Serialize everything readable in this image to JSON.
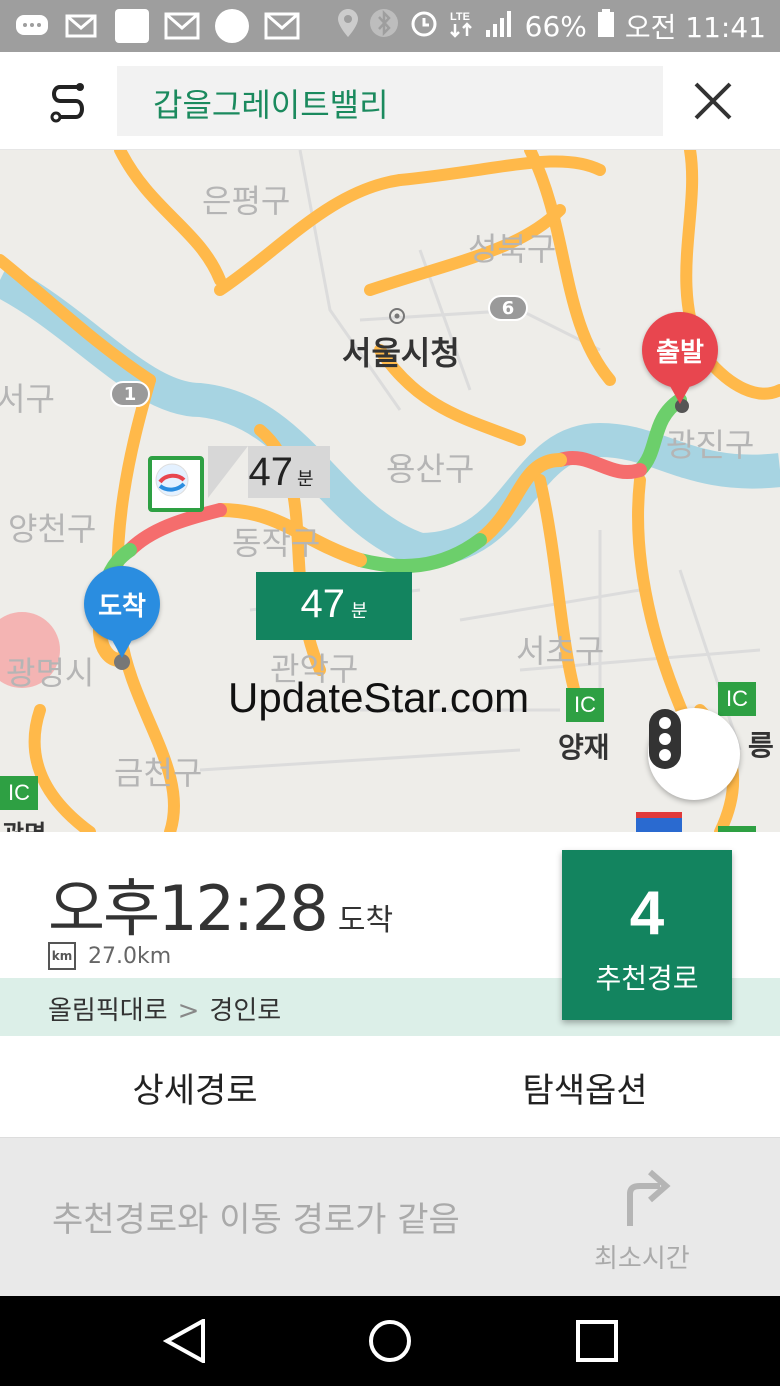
{
  "status_bar": {
    "battery_pct": "66%",
    "time": "오전 11:41"
  },
  "search": {
    "query": "갑을그레이트밸리"
  },
  "map": {
    "districts": [
      "은평구",
      "성북구",
      "서구",
      "양천구",
      "동작구",
      "관악구",
      "금천구",
      "서초구",
      "광진구",
      "용산구",
      "광명시"
    ],
    "landmarks": [
      "서울시청",
      "양재"
    ],
    "labels_partial": [
      "릉",
      "광명"
    ],
    "highways": [
      "1",
      "6"
    ],
    "ic_label": "IC",
    "start_pin": "출발",
    "end_pin": "도착",
    "route_time_main": {
      "num": "47",
      "unit": "분"
    },
    "route_time_alt": {
      "num": "47",
      "unit": "분"
    },
    "watermark": "UpdateStar.com"
  },
  "summary": {
    "eta_time": "오후12:28",
    "eta_label": "도착",
    "distance": "27.0km",
    "km_icon": "km",
    "via": [
      "올림픽대로",
      "경인로"
    ],
    "via_separator": ">",
    "recommended_count": "4",
    "recommended_label": "추천경로"
  },
  "tabs": {
    "detail": "상세경로",
    "options": "탐색옵션"
  },
  "note": {
    "text": "추천경로와 이동 경로가 같음",
    "fastest_label": "최소시간"
  },
  "colors": {
    "accent_green": "#13845f",
    "start_red": "#e8464f",
    "end_blue": "#2a8de0",
    "road_orange": "#ffb94a",
    "river_blue": "#a7d4e2"
  }
}
